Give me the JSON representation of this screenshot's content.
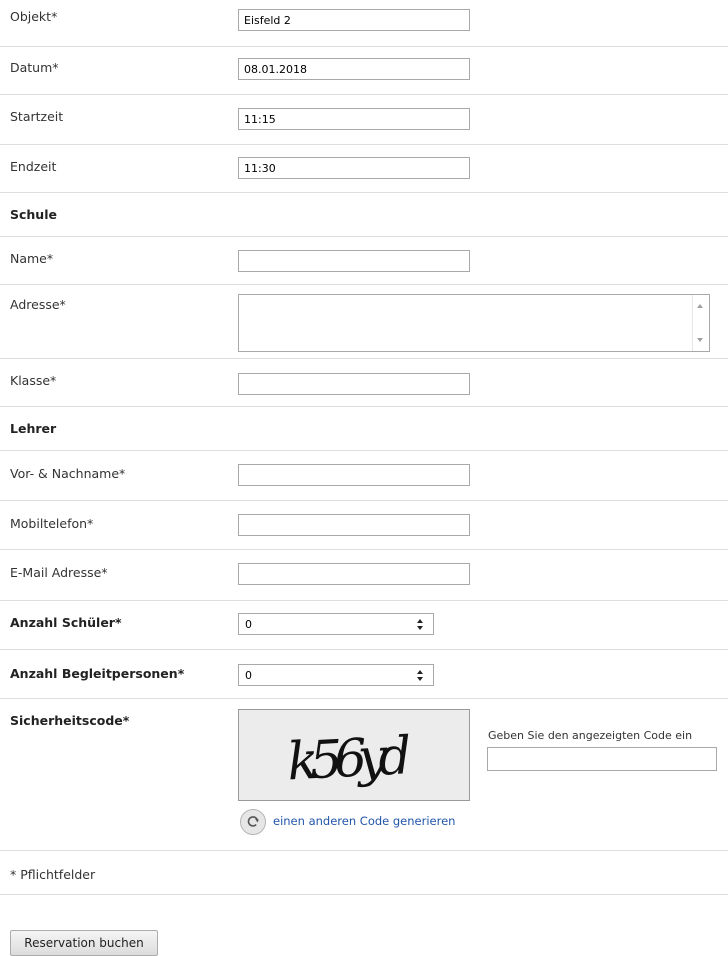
{
  "fields": {
    "objekt": {
      "label": "Objekt*",
      "value": "Eisfeld 2"
    },
    "datum": {
      "label": "Datum*",
      "value": "08.01.2018"
    },
    "startzeit": {
      "label": "Startzeit",
      "value": "11:15"
    },
    "endzeit": {
      "label": "Endzeit",
      "value": "11:30"
    }
  },
  "schule": {
    "heading": "Schule",
    "name_label": "Name*",
    "name_value": "",
    "adresse_label": "Adresse*",
    "adresse_value": "",
    "klasse_label": "Klasse*",
    "klasse_value": ""
  },
  "lehrer": {
    "heading": "Lehrer",
    "name_label": "Vor- & Nachname*",
    "name_value": "",
    "mobil_label": "Mobiltelefon*",
    "mobil_value": "",
    "email_label": "E-Mail Adresse*",
    "email_value": ""
  },
  "counts": {
    "schueler_label": "Anzahl Schüler*",
    "schueler_value": "0",
    "begleit_label": "Anzahl Begleitpersonen*",
    "begleit_value": "0"
  },
  "captcha": {
    "label": "Sicherheitscode*",
    "image_text": "k56yd",
    "refresh_link": "einen anderen Code generieren",
    "code_label": "Geben Sie den angezeigten Code ein",
    "code_value": ""
  },
  "footer": {
    "required_note": "* Pflichtfelder",
    "submit_label": "Reservation buchen"
  }
}
